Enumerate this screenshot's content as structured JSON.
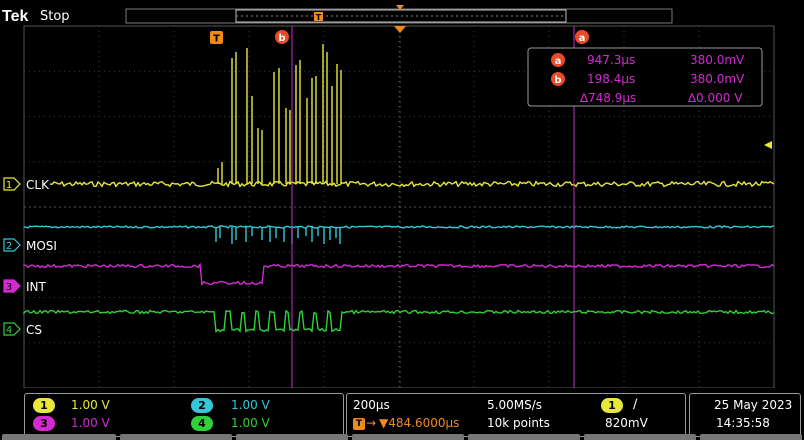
{
  "brand": {
    "logo": "Tek",
    "status": "Stop"
  },
  "markers": {
    "trigger": "T",
    "cursor_a": "a",
    "cursor_b": "b"
  },
  "cursor_readout": {
    "a": {
      "time": "947.3µs",
      "volt": "380.0mV"
    },
    "b": {
      "time": "198.4µs",
      "volt": "380.0mV"
    },
    "delta": {
      "time": "∆748.9µs",
      "volt": "∆0.000 V"
    }
  },
  "channels": [
    {
      "num": "1",
      "label": "CLK",
      "scale": "1.00 V",
      "color": "#e8e83a"
    },
    {
      "num": "2",
      "label": "MOSI",
      "scale": "1.00 V",
      "color": "#33c8d8"
    },
    {
      "num": "3",
      "label": "INT",
      "scale": "1.00 V",
      "color": "#d22bd2"
    },
    {
      "num": "4",
      "label": "CS",
      "scale": "1.00 V",
      "color": "#2fd23a"
    }
  ],
  "horizontal": {
    "scale": "200µs",
    "sample_rate": "5.00MS/s",
    "position": "▼484.6000µs",
    "record_length": "10k points"
  },
  "trigger": {
    "source": "1",
    "slope": "∕",
    "level": "820mV"
  },
  "datetime": {
    "date": "25 May 2023",
    "time": "14:35:58"
  }
}
